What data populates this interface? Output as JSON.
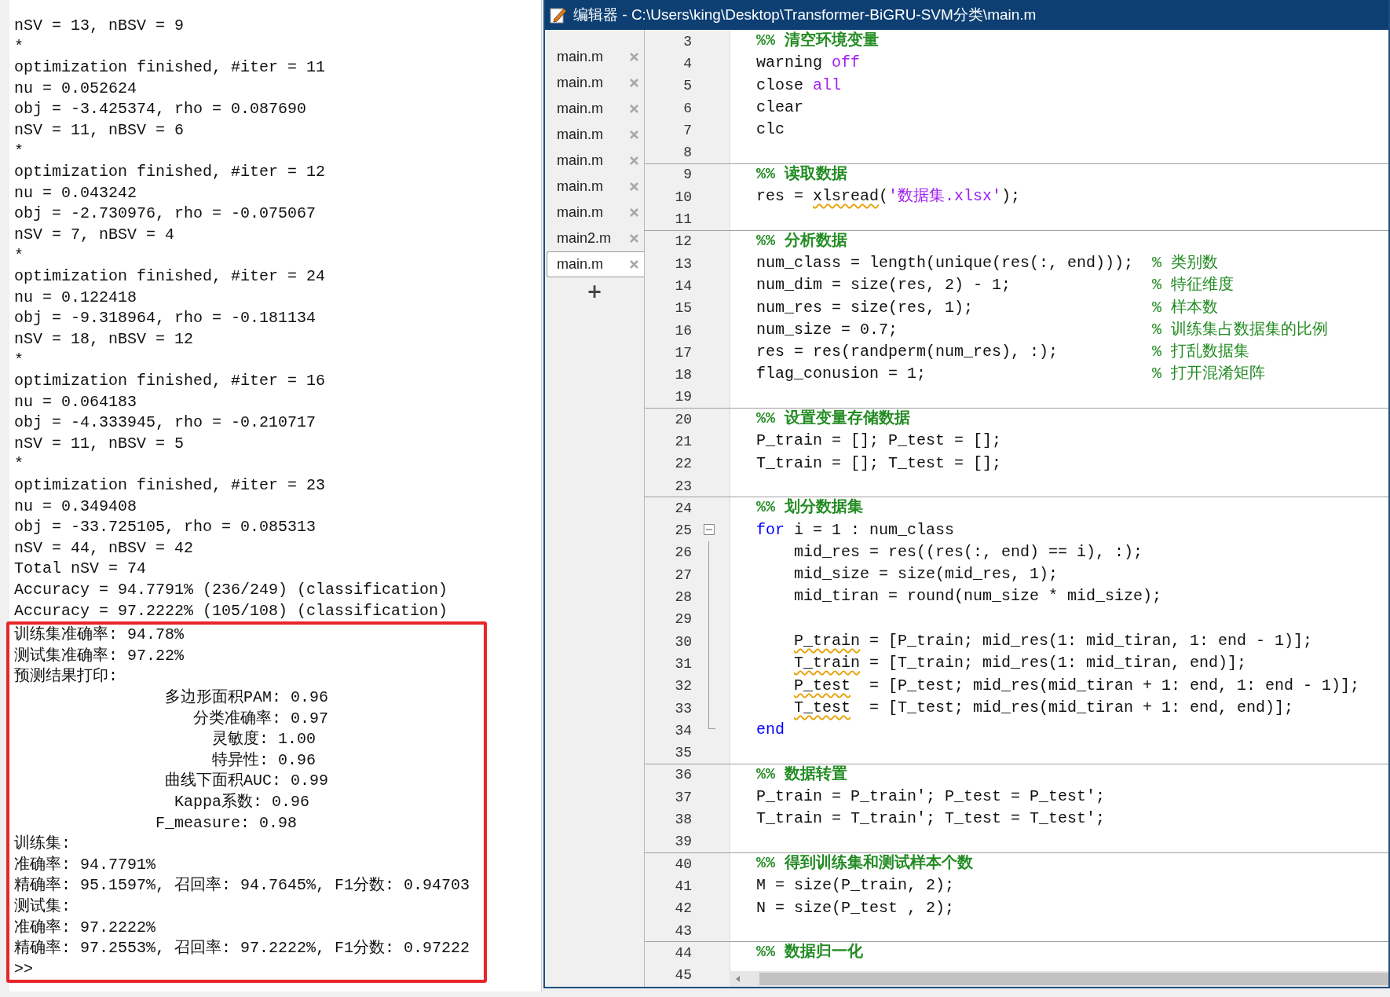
{
  "console": {
    "lines": [
      "nSV = 13, nBSV = 9",
      "*",
      "optimization finished, #iter = 11",
      "nu = 0.052624",
      "obj = -3.425374, rho = 0.087690",
      "nSV = 11, nBSV = 6",
      "*",
      "optimization finished, #iter = 12",
      "nu = 0.043242",
      "obj = -2.730976, rho = -0.075067",
      "nSV = 7, nBSV = 4",
      "*",
      "optimization finished, #iter = 24",
      "nu = 0.122418",
      "obj = -9.318964, rho = -0.181134",
      "nSV = 18, nBSV = 12",
      "*",
      "optimization finished, #iter = 16",
      "nu = 0.064183",
      "obj = -4.333945, rho = -0.210717",
      "nSV = 11, nBSV = 5",
      "*",
      "optimization finished, #iter = 23",
      "nu = 0.349408",
      "obj = -33.725105, rho = 0.085313",
      "nSV = 44, nBSV = 42",
      "Total nSV = 74",
      "Accuracy = 94.7791% (236/249) (classification)",
      "Accuracy = 97.2222% (105/108) (classification)"
    ],
    "results": {
      "highlighted": true,
      "lines": [
        "训练集准确率: 94.78%",
        "测试集准确率: 97.22%",
        "预测结果打印:",
        "                多边形面积PAM: 0.96",
        "                   分类准确率: 0.97",
        "                     灵敏度: 1.00",
        "                     特异性: 0.96",
        "                曲线下面积AUC: 0.99",
        "                 Kappa系数: 0.96",
        "               F_measure: 0.98",
        "训练集:",
        "准确率: 94.7791%",
        "精确率: 95.1597%, 召回率: 94.7645%, F1分数: 0.94703",
        "测试集:",
        "准确率: 97.2222%",
        "精确率: 97.2553%, 召回率: 97.2222%, F1分数: 0.97222"
      ],
      "prompt": ">>"
    }
  },
  "editor": {
    "title": "编辑器 - C:\\Users\\king\\Desktop\\Transformer-BiGRU-SVM分类\\main.m",
    "tabs": [
      {
        "label": "main.m",
        "selected": false
      },
      {
        "label": "main.m",
        "selected": false
      },
      {
        "label": "main.m",
        "selected": false
      },
      {
        "label": "main.m",
        "selected": false
      },
      {
        "label": "main.m",
        "selected": false
      },
      {
        "label": "main.m",
        "selected": false
      },
      {
        "label": "main.m",
        "selected": false
      },
      {
        "label": "main2.m",
        "selected": false
      },
      {
        "label": "main.m",
        "selected": true
      }
    ],
    "add_tab": "+",
    "lines": [
      {
        "number": "3",
        "cell_start": false,
        "segments": [
          {
            "text": "%% 清空环境变量",
            "kind": "section"
          }
        ]
      },
      {
        "number": "4",
        "cell_start": false,
        "segments": [
          {
            "text": "warning ",
            "kind": "plain"
          },
          {
            "text": "off",
            "kind": "string"
          }
        ]
      },
      {
        "number": "5",
        "cell_start": false,
        "segments": [
          {
            "text": "close ",
            "kind": "plain"
          },
          {
            "text": "all",
            "kind": "string"
          }
        ]
      },
      {
        "number": "6",
        "cell_start": false,
        "segments": [
          {
            "text": "clear",
            "kind": "plain"
          }
        ]
      },
      {
        "number": "7",
        "cell_start": false,
        "segments": [
          {
            "text": "clc",
            "kind": "plain"
          }
        ]
      },
      {
        "number": "8",
        "cell_start": false
      },
      {
        "number": "9",
        "cell_start": true,
        "segments": [
          {
            "text": "%% 读取数据",
            "kind": "section"
          }
        ]
      },
      {
        "number": "10",
        "cell_start": false,
        "segments": [
          {
            "text": "res = ",
            "kind": "plain"
          },
          {
            "text": "xlsread",
            "kind": "warn"
          },
          {
            "text": "(",
            "kind": "plain"
          },
          {
            "text": "'数据集.xlsx'",
            "kind": "string"
          },
          {
            "text": ");",
            "kind": "plain"
          }
        ]
      },
      {
        "number": "11",
        "cell_start": false
      },
      {
        "number": "12",
        "cell_start": true,
        "segments": [
          {
            "text": "%% 分析数据",
            "kind": "section"
          }
        ]
      },
      {
        "number": "13",
        "cell_start": false,
        "segments": [
          {
            "text": "num_class = length(unique(res(:, end)));  ",
            "kind": "plain"
          },
          {
            "text": "% 类别数",
            "kind": "comment"
          }
        ]
      },
      {
        "number": "14",
        "cell_start": false,
        "segments": [
          {
            "text": "num_dim = size(res, 2) - 1;               ",
            "kind": "plain"
          },
          {
            "text": "% 特征维度",
            "kind": "comment"
          }
        ]
      },
      {
        "number": "15",
        "cell_start": false,
        "segments": [
          {
            "text": "num_res = size(res, 1);                   ",
            "kind": "plain"
          },
          {
            "text": "% 样本数",
            "kind": "comment"
          }
        ]
      },
      {
        "number": "16",
        "cell_start": false,
        "segments": [
          {
            "text": "num_size = 0.7;                           ",
            "kind": "plain"
          },
          {
            "text": "% 训练集占数据集的比例",
            "kind": "comment"
          }
        ]
      },
      {
        "number": "17",
        "cell_start": false,
        "segments": [
          {
            "text": "res = res(randperm(num_res), :);          ",
            "kind": "plain"
          },
          {
            "text": "% 打乱数据集",
            "kind": "comment"
          }
        ]
      },
      {
        "number": "18",
        "cell_start": false,
        "segments": [
          {
            "text": "flag_conusion = 1;                        ",
            "kind": "plain"
          },
          {
            "text": "% 打开混淆矩阵",
            "kind": "comment"
          }
        ]
      },
      {
        "number": "19",
        "cell_start": false
      },
      {
        "number": "20",
        "cell_start": true,
        "segments": [
          {
            "text": "%% 设置变量存储数据",
            "kind": "section"
          }
        ]
      },
      {
        "number": "21",
        "cell_start": false,
        "segments": [
          {
            "text": "P_train = []; P_test = [];",
            "kind": "plain"
          }
        ]
      },
      {
        "number": "22",
        "cell_start": false,
        "segments": [
          {
            "text": "T_train = []; T_test = [];",
            "kind": "plain"
          }
        ]
      },
      {
        "number": "23",
        "cell_start": false
      },
      {
        "number": "24",
        "cell_start": true,
        "segments": [
          {
            "text": "%% 划分数据集",
            "kind": "section"
          }
        ]
      },
      {
        "number": "25",
        "cell_start": false,
        "kind": "opener",
        "segments": [
          {
            "text": "for",
            "kind": "keyword"
          },
          {
            "text": " i = 1 : num_class",
            "kind": "plain"
          }
        ]
      },
      {
        "number": "26",
        "cell_start": false,
        "kind": "body",
        "segments": [
          {
            "text": "mid_res = res((res(:, end) == i), :);",
            "kind": "plain"
          }
        ]
      },
      {
        "number": "27",
        "cell_start": false,
        "kind": "body",
        "segments": [
          {
            "text": "mid_size = size(mid_res, 1);",
            "kind": "plain"
          }
        ]
      },
      {
        "number": "28",
        "cell_start": false,
        "kind": "body",
        "segments": [
          {
            "text": "mid_tiran = round(num_size * mid_size);",
            "kind": "plain"
          }
        ]
      },
      {
        "number": "29",
        "cell_start": false,
        "kind": "body"
      },
      {
        "number": "30",
        "cell_start": false,
        "kind": "body",
        "segments": [
          {
            "text": "P_train",
            "kind": "warn"
          },
          {
            "text": " = [P_train; mid_res(1: mid_tiran, 1: end - 1)];",
            "kind": "plain"
          }
        ]
      },
      {
        "number": "31",
        "cell_start": false,
        "kind": "body",
        "segments": [
          {
            "text": "T_train",
            "kind": "warn"
          },
          {
            "text": " = [T_train; mid_res(1: mid_tiran, end)];",
            "kind": "plain"
          }
        ]
      },
      {
        "number": "32",
        "cell_start": false,
        "kind": "body",
        "segments": [
          {
            "text": "P_test",
            "kind": "warn"
          },
          {
            "text": "  = [P_test; mid_res(mid_tiran + 1: end, 1: end - 1)];",
            "kind": "plain"
          }
        ]
      },
      {
        "number": "33",
        "cell_start": false,
        "kind": "body",
        "segments": [
          {
            "text": "T_test",
            "kind": "warn"
          },
          {
            "text": "  = [T_test; mid_res(mid_tiran + 1: end, end)];",
            "kind": "plain"
          }
        ]
      },
      {
        "number": "34",
        "cell_start": false,
        "kind": "closer",
        "segments": [
          {
            "text": "end",
            "kind": "keyword"
          }
        ]
      },
      {
        "number": "35",
        "cell_start": false
      },
      {
        "number": "36",
        "cell_start": true,
        "segments": [
          {
            "text": "%% 数据转置",
            "kind": "section"
          }
        ]
      },
      {
        "number": "37",
        "cell_start": false,
        "segments": [
          {
            "text": "P_train = P_train'; P_test = P_test';",
            "kind": "plain"
          }
        ]
      },
      {
        "number": "38",
        "cell_start": false,
        "segments": [
          {
            "text": "T_train = T_train'; T_test = T_test';",
            "kind": "plain"
          }
        ]
      },
      {
        "number": "39",
        "cell_start": false
      },
      {
        "number": "40",
        "cell_start": true,
        "segments": [
          {
            "text": "%% 得到训练集和测试样本个数",
            "kind": "section"
          }
        ]
      },
      {
        "number": "41",
        "cell_start": false,
        "segments": [
          {
            "text": "M = size(P_train, 2);",
            "kind": "plain"
          }
        ]
      },
      {
        "number": "42",
        "cell_start": false,
        "segments": [
          {
            "text": "N = size(P_test , 2);",
            "kind": "plain"
          }
        ]
      },
      {
        "number": "43",
        "cell_start": false
      },
      {
        "number": "44",
        "cell_start": true,
        "segments": [
          {
            "text": "%% 数据归一化",
            "kind": "section"
          }
        ]
      },
      {
        "number": "45",
        "cell_start": false
      }
    ]
  }
}
